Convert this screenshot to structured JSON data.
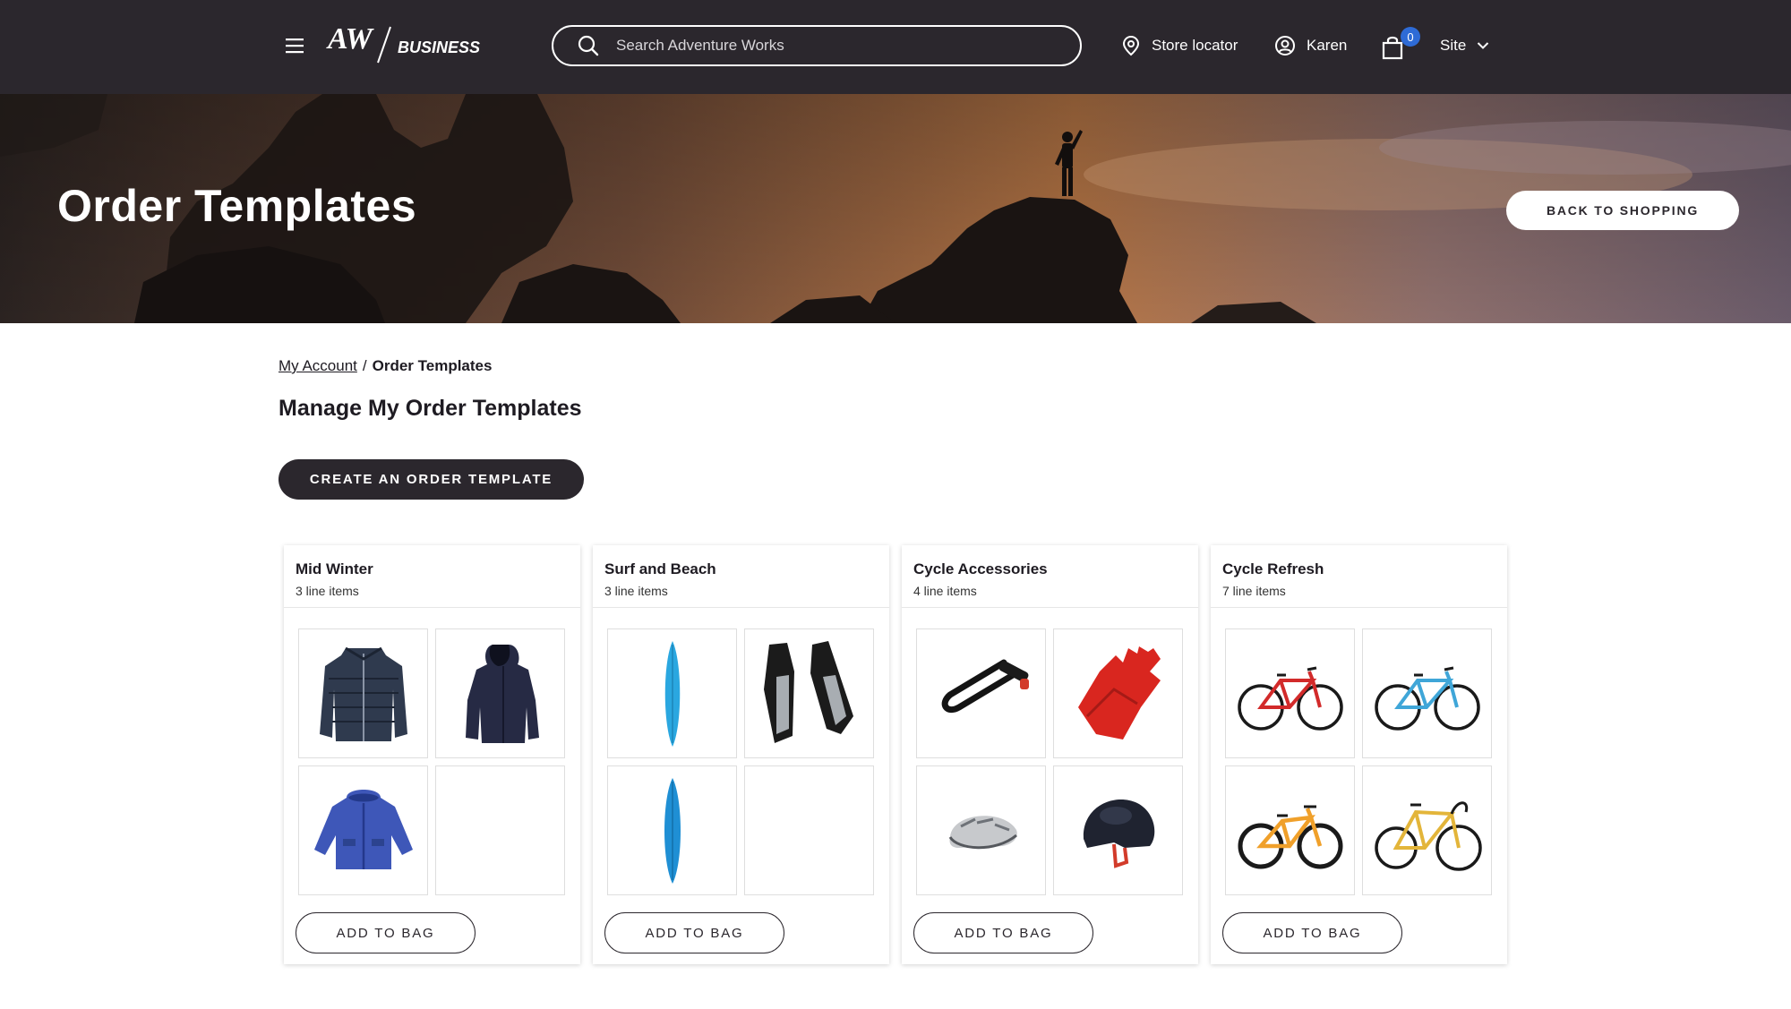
{
  "header": {
    "logo_text": "AW",
    "logo_subtext": "BUSINESS",
    "search_placeholder": "Search Adventure Works",
    "store_locator": "Store locator",
    "user_name": "Karen",
    "cart_count": "0",
    "site_label": "Site"
  },
  "hero": {
    "title": "Order Templates",
    "back_button": "BACK TO SHOPPING"
  },
  "breadcrumb": {
    "parent": "My Account",
    "separator": "/",
    "current": "Order Templates"
  },
  "page_title": "Manage My Order Templates",
  "create_button": "CREATE AN ORDER TEMPLATE",
  "templates": [
    {
      "name": "Mid Winter",
      "count": "3 line items",
      "button": "ADD TO BAG",
      "products": [
        "puffer-jacket",
        "hooded-jacket",
        "kids-parka",
        "empty"
      ]
    },
    {
      "name": "Surf and Beach",
      "count": "3 line items",
      "button": "ADD TO BAG",
      "products": [
        "surfboard",
        "swim-fins",
        "surfboard",
        "empty"
      ]
    },
    {
      "name": "Cycle Accessories",
      "count": "4 line items",
      "button": "ADD TO BAG",
      "products": [
        "u-lock",
        "cycling-glove",
        "bike-helmet",
        "skate-helmet"
      ]
    },
    {
      "name": "Cycle Refresh",
      "count": "7 line items",
      "button": "ADD TO BAG",
      "products": [
        "red-road-bike",
        "blue-road-bike",
        "orange-mountain-bike",
        "yellow-road-bike"
      ]
    }
  ],
  "colors": {
    "header_bg": "#2b272d",
    "badge": "#2e6bd6",
    "primary_button": "#2b272d"
  }
}
